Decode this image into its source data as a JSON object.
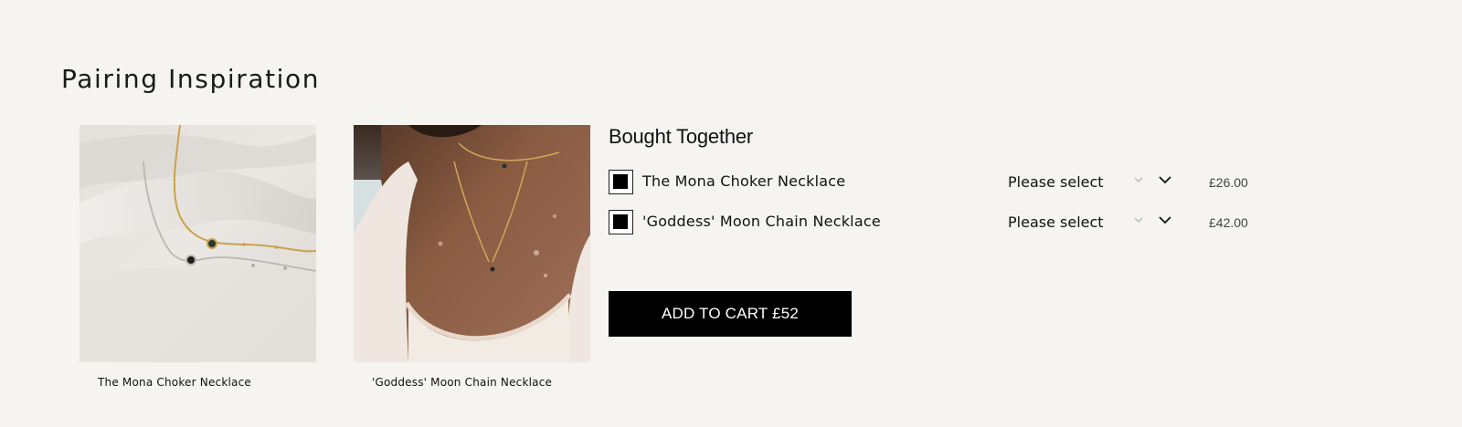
{
  "section": {
    "heading": "Pairing Inspiration"
  },
  "products": [
    {
      "caption": "The Mona Choker Necklace",
      "image": "necklace-on-silk-photo"
    },
    {
      "caption": "'Goddess' Moon Chain Necklace",
      "image": "model-wearing-moon-necklace-photo"
    }
  ],
  "bundle": {
    "title": "Bought Together",
    "items": [
      {
        "checked": true,
        "name": "The Mona Choker Necklace",
        "select_value": "Please select",
        "price": "£26.00"
      },
      {
        "checked": true,
        "name": "'Goddess' Moon Chain Necklace",
        "select_value": "Please select",
        "price": "£42.00"
      }
    ],
    "add_to_cart_label": "ADD TO CART £52"
  },
  "icons": {
    "small_chevron": "chevron-down-icon",
    "dropdown_chevron": "chevron-down-icon"
  },
  "colors": {
    "background": "#f5f4f1",
    "button": "#000000",
    "button_text": "#ffffff",
    "price_text": "#444444"
  }
}
